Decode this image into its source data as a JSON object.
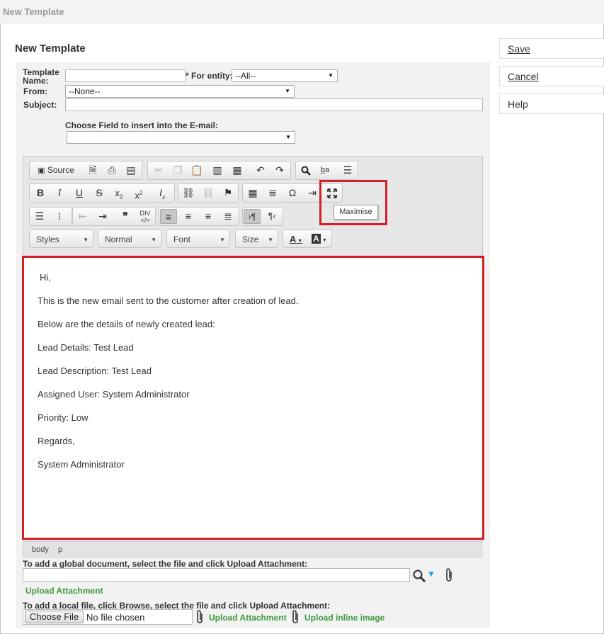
{
  "window": {
    "title": "New Template"
  },
  "page": {
    "heading": "New Template"
  },
  "actions": {
    "save": "Save",
    "cancel": "Cancel",
    "help": "Help"
  },
  "form": {
    "template_name_label": "Template Name:",
    "template_name_value": "",
    "required_mark": "*",
    "for_entity_label": "For entity:",
    "for_entity_value": "--All--",
    "from_label": "From:",
    "from_value": "--None--",
    "subject_label": "Subject:",
    "subject_value": "",
    "choose_field_label": "Choose Field to insert into the E-mail:",
    "choose_field_value": ""
  },
  "editor": {
    "toolbar": {
      "source": "Source",
      "styles": "Styles",
      "format": "Normal",
      "font": "Font",
      "size": "Size"
    },
    "maximise_tooltip": "Maximise",
    "content": [
      "Hi,",
      "This is the new email sent to the customer after creation of lead.",
      "Below are the details of newly created lead:",
      "Lead Details: Test Lead",
      "Lead Description: Test Lead",
      "Assigned User: System Administrator",
      "Priority: Low",
      "Regards,",
      "System Administrator"
    ],
    "path": [
      "body",
      "p"
    ]
  },
  "attachments": {
    "global_hint": "To add a global document, select the file and click Upload Attachment:",
    "global_value": "",
    "upload_attachment": "Upload Attachment",
    "local_hint": "To add a local file, click Browse, select the file and click Upload Attachment:",
    "choose_file": "Choose File",
    "no_file": "No file chosen",
    "upload_attachment_2": "Upload Attachment",
    "upload_inline": "Upload inline image"
  },
  "colors": {
    "highlight": "#d32027",
    "link_green": "#3f9a3f"
  }
}
